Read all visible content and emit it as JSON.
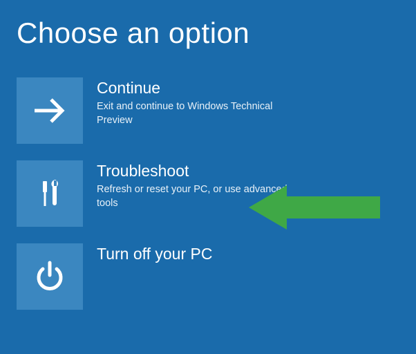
{
  "title": "Choose an option",
  "options": [
    {
      "icon": "arrow-right-icon",
      "title": "Continue",
      "desc": "Exit and continue to Windows Technical Preview"
    },
    {
      "icon": "tools-icon",
      "title": "Troubleshoot",
      "desc": "Refresh or reset your PC, or use advanced tools"
    },
    {
      "icon": "power-icon",
      "title": "Turn off your PC",
      "desc": ""
    }
  ],
  "annotation": {
    "color": "#3fa846"
  }
}
